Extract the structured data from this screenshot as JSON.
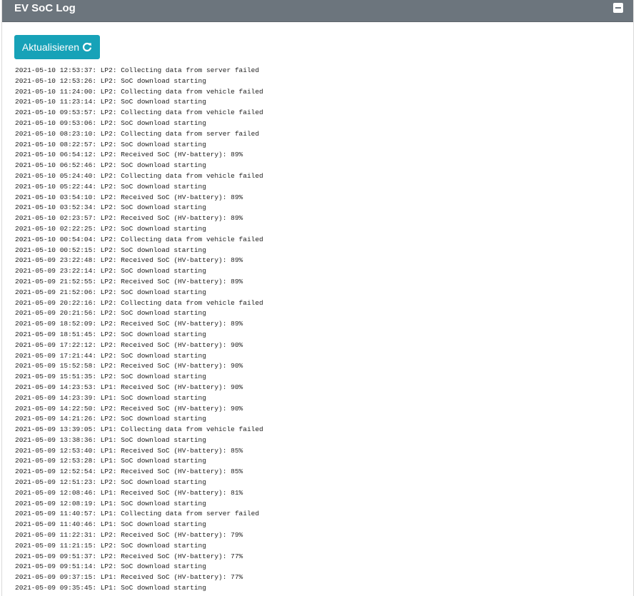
{
  "header": {
    "title": "EV SoC Log",
    "collapse_icon": "minus-square-icon",
    "color": "#6c757d"
  },
  "toolbar": {
    "refresh_label": "Aktualisieren",
    "refresh_icon": "refresh-icon",
    "refresh_color": "#17a2b8"
  },
  "log": {
    "lines": [
      "2021-05-10 12:53:37: LP2: Collecting data from server failed",
      "2021-05-10 12:53:26: LP2: SoC download starting",
      "2021-05-10 11:24:00: LP2: Collecting data from vehicle failed",
      "2021-05-10 11:23:14: LP2: SoC download starting",
      "2021-05-10 09:53:57: LP2: Collecting data from vehicle failed",
      "2021-05-10 09:53:06: LP2: SoC download starting",
      "2021-05-10 08:23:10: LP2: Collecting data from server failed",
      "2021-05-10 08:22:57: LP2: SoC download starting",
      "2021-05-10 06:54:12: LP2: Received SoC (HV-battery): 89%",
      "2021-05-10 06:52:46: LP2: SoC download starting",
      "2021-05-10 05:24:40: LP2: Collecting data from vehicle failed",
      "2021-05-10 05:22:44: LP2: SoC download starting",
      "2021-05-10 03:54:10: LP2: Received SoC (HV-battery): 89%",
      "2021-05-10 03:52:34: LP2: SoC download starting",
      "2021-05-10 02:23:57: LP2: Received SoC (HV-battery): 89%",
      "2021-05-10 02:22:25: LP2: SoC download starting",
      "2021-05-10 00:54:04: LP2: Collecting data from vehicle failed",
      "2021-05-10 00:52:15: LP2: SoC download starting",
      "2021-05-09 23:22:48: LP2: Received SoC (HV-battery): 89%",
      "2021-05-09 23:22:14: LP2: SoC download starting",
      "2021-05-09 21:52:55: LP2: Received SoC (HV-battery): 89%",
      "2021-05-09 21:52:06: LP2: SoC download starting",
      "2021-05-09 20:22:16: LP2: Collecting data from vehicle failed",
      "2021-05-09 20:21:56: LP2: SoC download starting",
      "2021-05-09 18:52:09: LP2: Received SoC (HV-battery): 89%",
      "2021-05-09 18:51:45: LP2: SoC download starting",
      "2021-05-09 17:22:12: LP2: Received SoC (HV-battery): 90%",
      "2021-05-09 17:21:44: LP2: SoC download starting",
      "2021-05-09 15:52:58: LP2: Received SoC (HV-battery): 90%",
      "2021-05-09 15:51:35: LP2: SoC download starting",
      "2021-05-09 14:23:53: LP1: Received SoC (HV-battery): 90%",
      "2021-05-09 14:23:39: LP1: SoC download starting",
      "2021-05-09 14:22:50: LP2: Received SoC (HV-battery): 90%",
      "2021-05-09 14:21:26: LP2: SoC download starting",
      "2021-05-09 13:39:05: LP1: Collecting data from vehicle failed",
      "2021-05-09 13:38:36: LP1: SoC download starting",
      "2021-05-09 12:53:40: LP1: Received SoC (HV-battery): 85%",
      "2021-05-09 12:53:28: LP1: SoC download starting",
      "2021-05-09 12:52:54: LP2: Received SoC (HV-battery): 85%",
      "2021-05-09 12:51:23: LP2: SoC download starting",
      "2021-05-09 12:08:46: LP1: Received SoC (HV-battery): 81%",
      "2021-05-09 12:08:19: LP1: SoC download starting",
      "2021-05-09 11:40:57: LP1: Collecting data from server failed",
      "2021-05-09 11:40:46: LP1: SoC download starting",
      "2021-05-09 11:22:31: LP2: Received SoC (HV-battery): 79%",
      "2021-05-09 11:21:15: LP2: SoC download starting",
      "2021-05-09 09:51:37: LP2: Received SoC (HV-battery): 77%",
      "2021-05-09 09:51:14: LP2: SoC download starting",
      "2021-05-09 09:37:15: LP1: Received SoC (HV-battery): 77%",
      "2021-05-09 09:35:45: LP1: SoC download starting"
    ]
  }
}
